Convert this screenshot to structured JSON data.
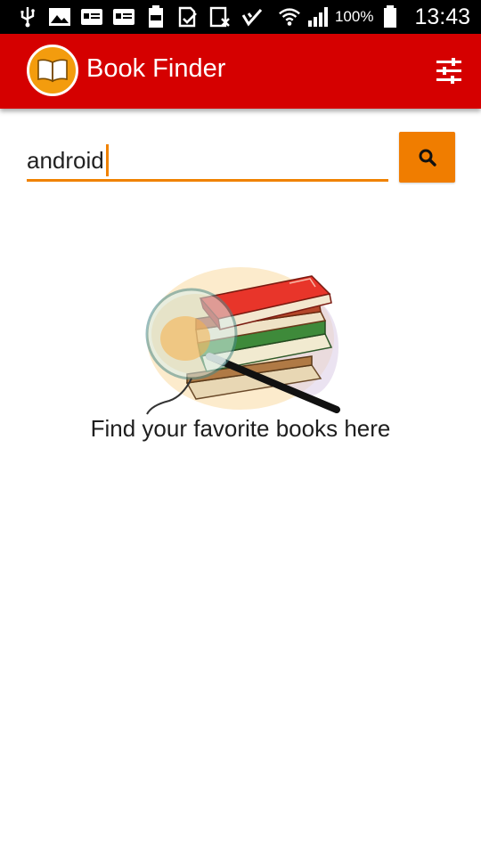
{
  "status_bar": {
    "battery_percent": "100%",
    "time": "13:43",
    "icons": [
      "usb-icon",
      "image-icon",
      "card-icon",
      "card-icon",
      "battery-100-icon",
      "download-check-icon",
      "blocked-icon",
      "check-icon",
      "wifi-icon",
      "signal-icon",
      "battery-icon"
    ]
  },
  "app_bar": {
    "title": "Book Finder",
    "logo_icon": "open-book-icon",
    "menu_icon": "sliders-icon",
    "color": "#d50000"
  },
  "search": {
    "value": "android",
    "button_icon": "search-icon",
    "accent_color": "#f07d00"
  },
  "empty_state": {
    "illustration": "books-with-magnifier",
    "message": "Find your favorite books here"
  }
}
